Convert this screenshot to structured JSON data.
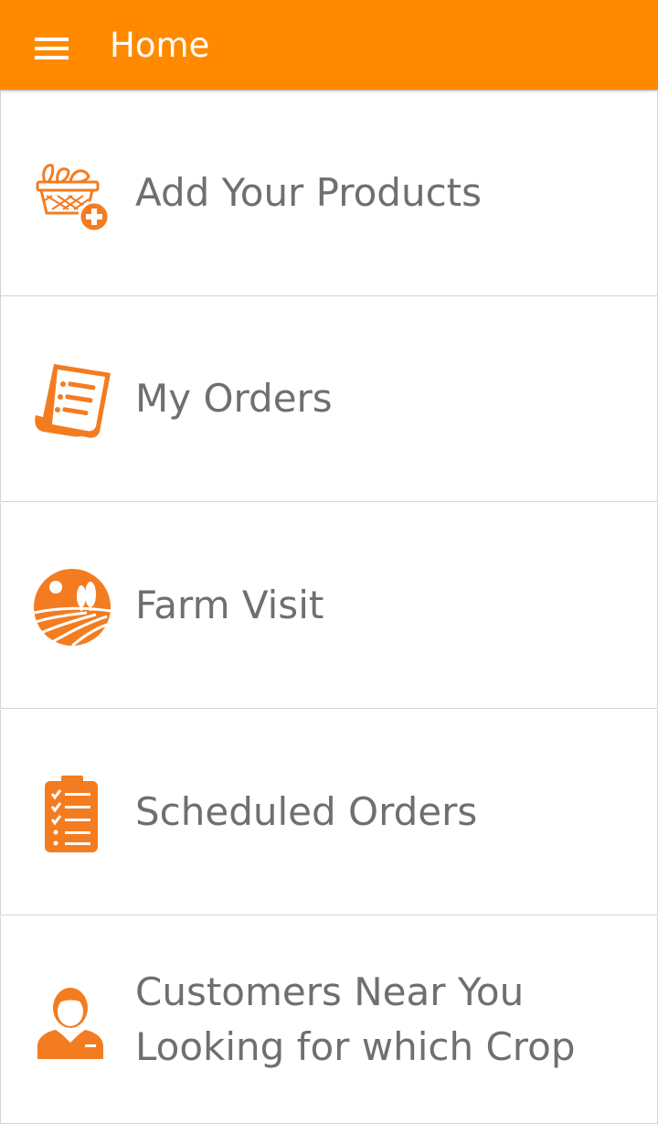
{
  "header": {
    "title": "Home",
    "menu_icon": "hamburger-menu-icon",
    "background_color": "#ff8a00"
  },
  "menu": {
    "accent_color": "#f47c20",
    "items": [
      {
        "label": "Add Your Products",
        "icon": "basket-add-icon"
      },
      {
        "label": "My Orders",
        "icon": "receipt-scroll-icon"
      },
      {
        "label": "Farm Visit",
        "icon": "farm-landscape-icon"
      },
      {
        "label": "Scheduled Orders",
        "icon": "clipboard-checklist-icon"
      },
      {
        "label_line1": "Customers Near You",
        "label_line2": "Looking for which Crop",
        "icon": "customer-person-icon"
      }
    ]
  }
}
